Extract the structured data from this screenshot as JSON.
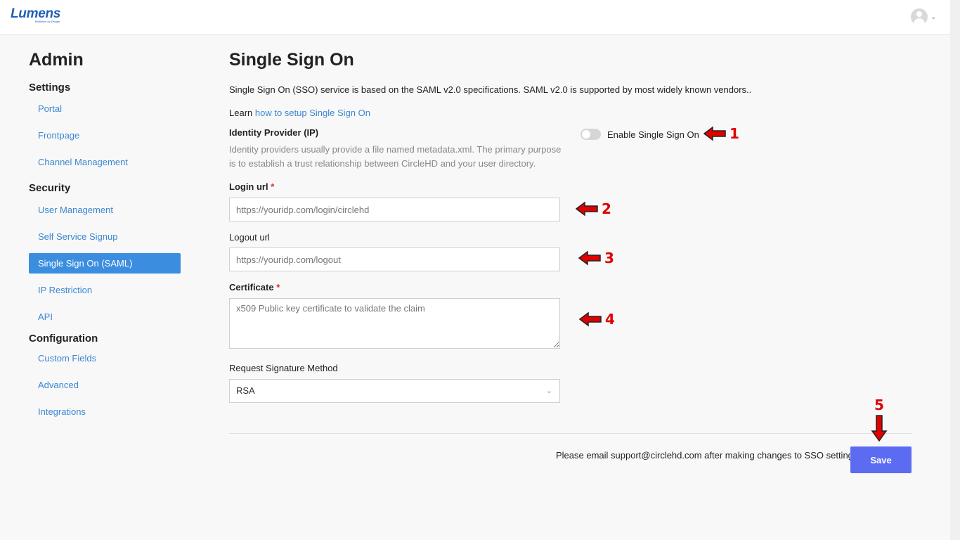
{
  "brand": {
    "logo": "Lumens",
    "tagline": "Brilliance by Design"
  },
  "header": {
    "avatar_icon": "user-avatar-icon",
    "menu_icon": "chevron-down-icon"
  },
  "sidebar": {
    "title": "Admin",
    "sections": [
      {
        "title": "Settings",
        "items": [
          "Portal",
          "Frontpage",
          "Channel Management"
        ]
      },
      {
        "title": "Security",
        "items": [
          "User Management",
          "Self Service Signup",
          "Single Sign On (SAML)",
          "IP Restriction",
          "API"
        ]
      },
      {
        "title": "Configuration",
        "items": [
          "Custom Fields",
          "Advanced",
          "Integrations"
        ]
      }
    ],
    "active_item": "Single Sign On (SAML)"
  },
  "main": {
    "title": "Single Sign On",
    "intro": "Single Sign On (SSO) service is based on the SAML v2.0 specifications. SAML v2.0 is supported by most widely known vendors..",
    "learn_prefix": "Learn",
    "learn_link": "how to setup Single Sign On",
    "identity_provider": {
      "title": "Identity Provider (IP)",
      "description": "Identity providers usually provide a file named metadata.xml. The primary purpose is to establish a trust relationship between CircleHD and your user directory."
    },
    "toggle": {
      "label": "Enable Single Sign On",
      "enabled": false
    },
    "login_url": {
      "label": "Login url",
      "required_mark": "*",
      "value": "",
      "placeholder": "https://youridp.com/login/circlehd"
    },
    "logout_url": {
      "label": "Logout url",
      "value": "",
      "placeholder": "https://youridp.com/logout"
    },
    "certificate": {
      "label": "Certificate",
      "required_mark": "*",
      "value": "",
      "placeholder": "x509 Public key certificate to validate the claim"
    },
    "signature_method": {
      "label": "Request Signature Method",
      "selected": "RSA"
    },
    "footer_note": "Please email support@circlehd.com after making changes to SSO settings.",
    "save_label": "Save"
  },
  "annotations": {
    "color": "#e00000",
    "labels": [
      "1",
      "2",
      "3",
      "4",
      "5"
    ]
  },
  "colors": {
    "accent": "#3b8de0",
    "link": "#3a87d2",
    "save_button": "#5b6cf2",
    "required": "#d9302c"
  }
}
